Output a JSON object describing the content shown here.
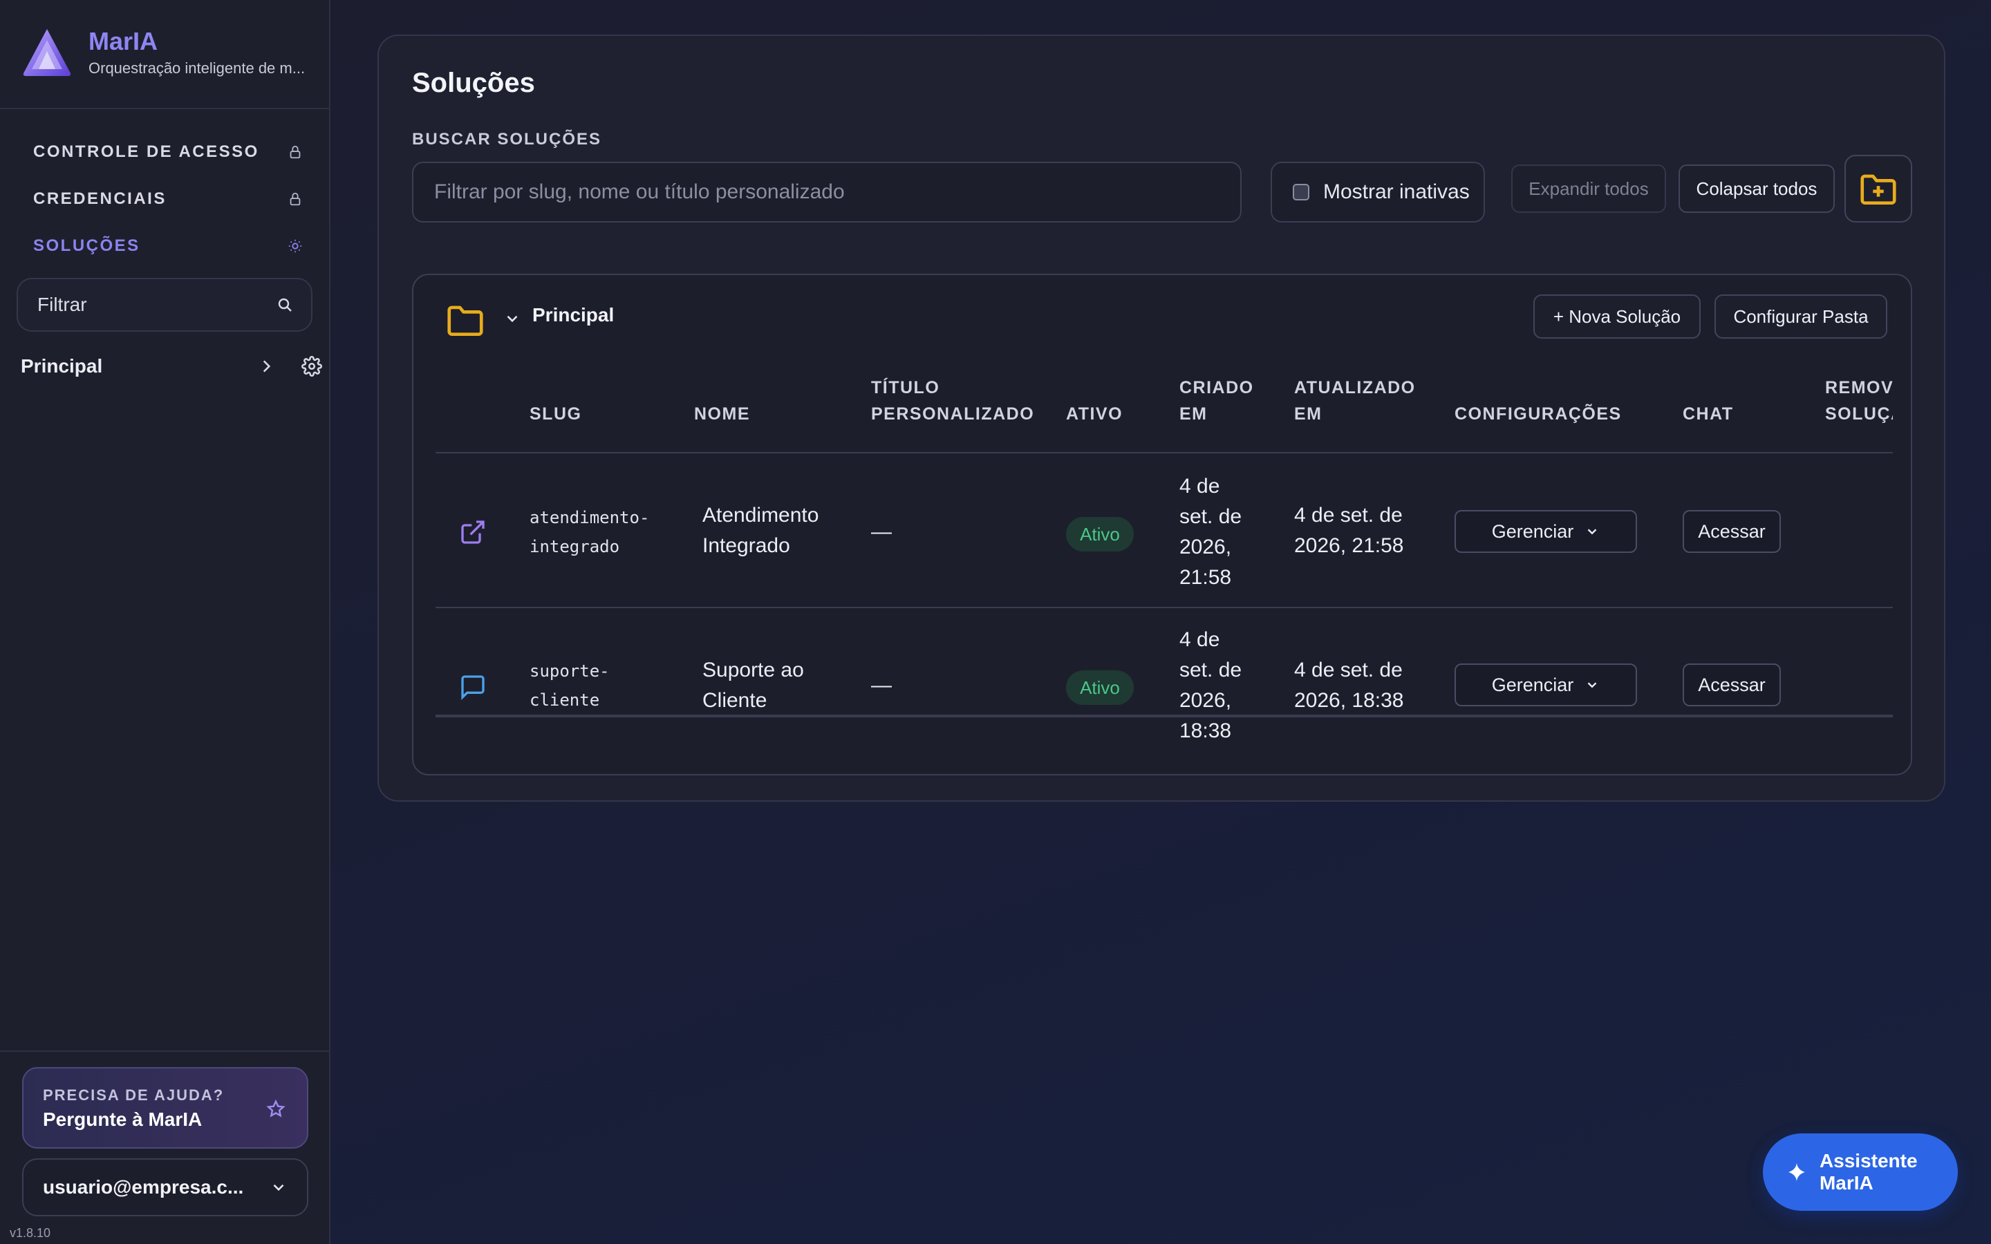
{
  "brand": {
    "name": "MarIA",
    "subtitle": "Orquestração inteligente de m..."
  },
  "sidebar": {
    "nav": [
      {
        "label": "CONTROLE DE ACESSO",
        "icon": "lock-icon"
      },
      {
        "label": "CREDENCIAIS",
        "icon": "lock-icon"
      },
      {
        "label": "SOLUÇÕES",
        "icon": "sun-icon",
        "active": true
      }
    ],
    "filter_placeholder": "Filtrar",
    "tree": [
      {
        "label": "Principal"
      }
    ],
    "help": {
      "small": "PRECISA DE AJUDA?",
      "big": "Pergunte à MarIA"
    },
    "user_email": "usuario@empresa.c...",
    "version": "v1.8.10"
  },
  "main": {
    "title": "Soluções",
    "search_label": "BUSCAR SOLUÇÕES",
    "search_placeholder": "Filtrar por slug, nome ou título personalizado",
    "show_inactive_label": "Mostrar inativas",
    "expand_all": "Expandir todos",
    "collapse_all": "Colapsar todos"
  },
  "folder": {
    "name": "Principal",
    "new_solution": "+ Nova Solução",
    "configure_folder": "Configurar Pasta",
    "columns": {
      "slug": "SLUG",
      "nome": "NOME",
      "titulo_1": "TÍTULO",
      "titulo_2": "PERSONALIZADO",
      "ativo": "ATIVO",
      "criado_1": "CRIADO",
      "criado_2": "EM",
      "atualizado_1": "ATUALIZADO",
      "atualizado_2": "EM",
      "configuracoes": "CONFIGURAÇÕES",
      "chat": "CHAT",
      "remover_1": "REMOV",
      "remover_2": "SOLUÇÃ"
    },
    "rows": [
      {
        "icon": "external-link-icon",
        "slug_1": "atendimento-",
        "slug_2": "integrado",
        "nome_1": "Atendimento",
        "nome_2": "Integrado",
        "titulo": "—",
        "ativo": "Ativo",
        "criado_1": "4 de",
        "criado_2": "set. de",
        "criado_3": "2026,",
        "criado_4": "21:58",
        "atualizado_1": "4 de set. de",
        "atualizado_2": "2026, 21:58",
        "manage": "Gerenciar",
        "access": "Acessar"
      },
      {
        "icon": "chat-bubble-icon",
        "slug_1": "suporte-",
        "slug_2": "cliente",
        "nome_1": "Suporte ao",
        "nome_2": "Cliente",
        "titulo": "—",
        "ativo": "Ativo",
        "criado_1": "4 de",
        "criado_2": "set. de",
        "criado_3": "2026,",
        "criado_4": "18:38",
        "atualizado_1": "4 de set. de",
        "atualizado_2": "2026, 18:38",
        "manage": "Gerenciar",
        "access": "Acessar"
      }
    ]
  },
  "assistant": {
    "label": "Assistente MarIA"
  },
  "colors": {
    "accent": "#8b84ef",
    "primary_button": "#2c66e6",
    "folder": "#e8ac1c",
    "success": "#4ac78a"
  }
}
